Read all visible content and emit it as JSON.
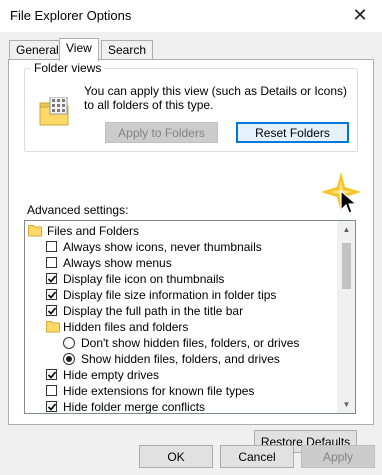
{
  "window": {
    "title": "File Explorer Options",
    "close_glyph": "✕"
  },
  "tabs": [
    {
      "label": "General"
    },
    {
      "label": "View"
    },
    {
      "label": "Search"
    }
  ],
  "folder_views": {
    "legend": "Folder views",
    "description": "You can apply this view (such as Details or Icons) to all folders of this type.",
    "apply_label": "Apply to Folders",
    "reset_label": "Reset Folders"
  },
  "advanced": {
    "label": "Advanced settings:",
    "items": [
      {
        "kind": "folder",
        "label": "Files and Folders",
        "level": 0
      },
      {
        "kind": "checkbox",
        "label": "Always show icons, never thumbnails",
        "checked": false,
        "level": 1
      },
      {
        "kind": "checkbox",
        "label": "Always show menus",
        "checked": false,
        "level": 1
      },
      {
        "kind": "checkbox",
        "label": "Display file icon on thumbnails",
        "checked": true,
        "level": 1
      },
      {
        "kind": "checkbox",
        "label": "Display file size information in folder tips",
        "checked": true,
        "level": 1
      },
      {
        "kind": "checkbox",
        "label": "Display the full path in the title bar",
        "checked": true,
        "level": 1
      },
      {
        "kind": "folder",
        "label": "Hidden files and folders",
        "level": 1
      },
      {
        "kind": "radio",
        "label": "Don't show hidden files, folders, or drives",
        "selected": false,
        "level": 2
      },
      {
        "kind": "radio",
        "label": "Show hidden files, folders, and drives",
        "selected": true,
        "level": 2
      },
      {
        "kind": "checkbox",
        "label": "Hide empty drives",
        "checked": true,
        "level": 1
      },
      {
        "kind": "checkbox",
        "label": "Hide extensions for known file types",
        "checked": false,
        "level": 1
      },
      {
        "kind": "checkbox",
        "label": "Hide folder merge conflicts",
        "checked": true,
        "level": 1
      }
    ]
  },
  "restore_label": "Restore Defaults",
  "footer": {
    "ok_label": "OK",
    "cancel_label": "Cancel",
    "apply_label": "Apply"
  },
  "icons": {
    "folder": "folder-icon",
    "folder_view": "folder-view-icon",
    "cursor": "mouse-cursor-icon",
    "scroll_up": "scroll-up-arrow-icon",
    "scroll_down": "scroll-down-arrow-icon"
  },
  "colors": {
    "accent": "#0078d7",
    "folder": "#ffd966",
    "dialog_bg": "#f0f0f0",
    "highlight": "#f5b800"
  }
}
